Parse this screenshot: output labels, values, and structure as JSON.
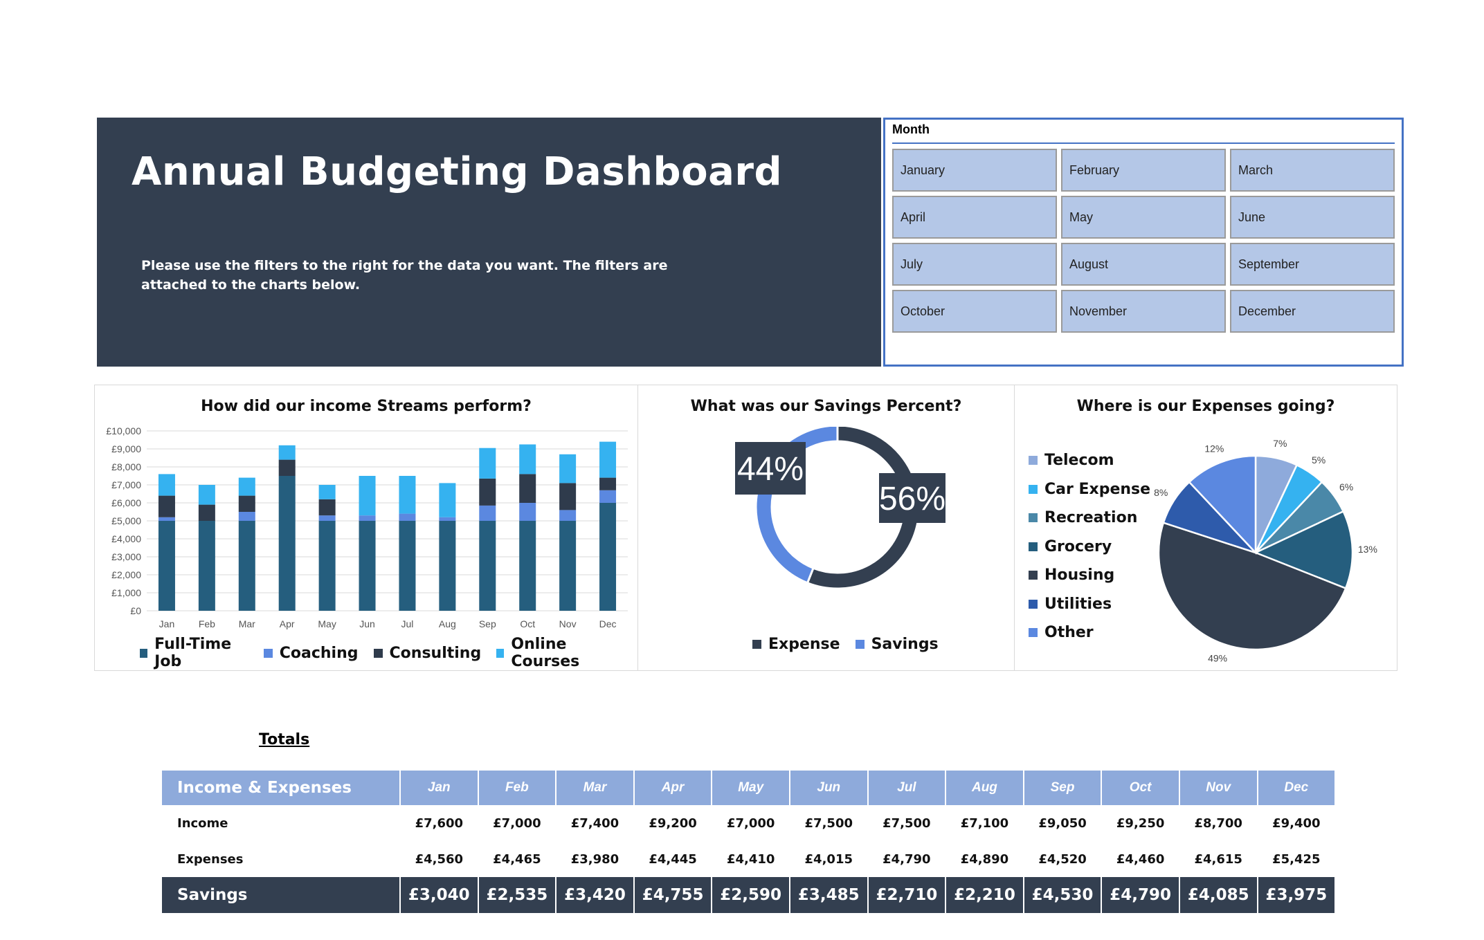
{
  "header": {
    "title": "Annual Budgeting Dashboard",
    "subtitle": "Please use the filters to the right for the data you want. The filters are attached to the charts below."
  },
  "slicer": {
    "title": "Month",
    "items": [
      "January",
      "February",
      "March",
      "April",
      "May",
      "June",
      "July",
      "August",
      "September",
      "October",
      "November",
      "December"
    ]
  },
  "colors": {
    "banner": "#333f50",
    "full_time_job": "#255e7e",
    "coaching": "#5b88e0",
    "consulting": "#2f3b4c",
    "online_courses": "#35b2f0",
    "slicer_button": "#b4c7e7",
    "table_header": "#8eaadb"
  },
  "chart_data": [
    {
      "type": "bar",
      "stacked": true,
      "title": "How did our income Streams perform?",
      "categories": [
        "Jan",
        "Feb",
        "Mar",
        "Apr",
        "May",
        "Jun",
        "Jul",
        "Aug",
        "Sep",
        "Oct",
        "Nov",
        "Dec"
      ],
      "series": [
        {
          "name": "Full-Time Job",
          "values": [
            5000,
            5000,
            5000,
            7500,
            5000,
            5000,
            5000,
            5000,
            5000,
            5000,
            5000,
            6000
          ]
        },
        {
          "name": "Coaching",
          "values": [
            200,
            0,
            500,
            0,
            300,
            300,
            400,
            200,
            850,
            1000,
            600,
            700
          ]
        },
        {
          "name": "Consulting",
          "values": [
            1200,
            900,
            900,
            900,
            900,
            0,
            0,
            0,
            1500,
            1600,
            1500,
            700
          ]
        },
        {
          "name": "Online Courses",
          "values": [
            1200,
            1100,
            1000,
            800,
            800,
            2200,
            2100,
            1900,
            1700,
            1650,
            1600,
            2000
          ]
        }
      ],
      "yticks": [
        "£0",
        "£1,000",
        "£2,000",
        "£3,000",
        "£4,000",
        "£5,000",
        "£6,000",
        "£7,000",
        "£8,000",
        "£9,000",
        "£10,000"
      ],
      "ylim": [
        0,
        10000
      ],
      "legend": "bottom",
      "grid": true
    },
    {
      "type": "pie",
      "donut": true,
      "title": "What was our Savings Percent?",
      "labels": [
        "Expense",
        "Savings"
      ],
      "values": [
        56,
        44
      ],
      "value_labels": [
        "56%",
        "44%"
      ],
      "legend": "bottom"
    },
    {
      "type": "pie",
      "title": "Where is our Expenses going?",
      "labels": [
        "Telecom",
        "Car Expense",
        "Recreation",
        "Grocery",
        "Housing",
        "Utilities",
        "Other"
      ],
      "values": [
        7,
        5,
        6,
        13,
        49,
        8,
        12
      ],
      "value_labels": [
        "7%",
        "5%",
        "6%",
        "13%",
        "49%",
        "8%",
        "12%"
      ],
      "colors": [
        "#8eaadb",
        "#35b2f0",
        "#4a88a8",
        "#255e7e",
        "#333f50",
        "#2e5bab",
        "#5b88e0"
      ],
      "legend": "left"
    }
  ],
  "legends": {
    "income": [
      {
        "label": "Full-Time Job",
        "color": "#255e7e"
      },
      {
        "label": "Coaching",
        "color": "#5b88e0"
      },
      {
        "label": "Consulting",
        "color": "#2f3b4c"
      },
      {
        "label": "Online Courses",
        "color": "#35b2f0"
      }
    ],
    "savings": [
      {
        "label": "Expense",
        "color": "#333f50"
      },
      {
        "label": "Savings",
        "color": "#5b88e0"
      }
    ],
    "expenses": [
      {
        "label": "Telecom",
        "color": "#8eaadb"
      },
      {
        "label": "Car Expense",
        "color": "#35b2f0"
      },
      {
        "label": "Recreation",
        "color": "#4a88a8"
      },
      {
        "label": "Grocery",
        "color": "#255e7e"
      },
      {
        "label": "Housing",
        "color": "#333f50"
      },
      {
        "label": "Utilities",
        "color": "#2e5bab"
      },
      {
        "label": "Other",
        "color": "#5b88e0"
      }
    ]
  },
  "totals": {
    "label": "Totals",
    "header": {
      "first": "Income & Expenses",
      "months": [
        "Jan",
        "Feb",
        "Mar",
        "Apr",
        "May",
        "Jun",
        "Jul",
        "Aug",
        "Sep",
        "Oct",
        "Nov",
        "Dec"
      ]
    },
    "rows": [
      {
        "label": "Income",
        "values": [
          "£7,600",
          "£7,000",
          "£7,400",
          "£9,200",
          "£7,000",
          "£7,500",
          "£7,500",
          "£7,100",
          "£9,050",
          "£9,250",
          "£8,700",
          "£9,400"
        ]
      },
      {
        "label": "Expenses",
        "values": [
          "£4,560",
          "£4,465",
          "£3,980",
          "£4,445",
          "£4,410",
          "£4,015",
          "£4,790",
          "£4,890",
          "£4,520",
          "£4,460",
          "£4,615",
          "£5,425"
        ]
      },
      {
        "label": "Savings",
        "values": [
          "£3,040",
          "£2,535",
          "£3,420",
          "£4,755",
          "£2,590",
          "£3,485",
          "£2,710",
          "£2,210",
          "£4,530",
          "£4,790",
          "£4,085",
          "£3,975"
        ]
      }
    ]
  }
}
